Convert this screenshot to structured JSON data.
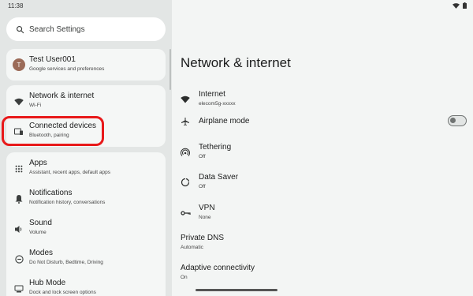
{
  "status_bar": {
    "time": "11:38"
  },
  "search": {
    "placeholder": "Search Settings"
  },
  "account": {
    "avatar_letter": "T",
    "name": "Test User001",
    "subtitle": "Google services and preferences"
  },
  "left_items": [
    {
      "title": "Network & internet",
      "subtitle": "Wi-Fi",
      "icon": "wifi-icon"
    },
    {
      "title": "Connected devices",
      "subtitle": "Bluetooth, pairing",
      "icon": "devices-icon"
    },
    {
      "title": "Apps",
      "subtitle": "Assistant, recent apps, default apps",
      "icon": "apps-grid-icon"
    },
    {
      "title": "Notifications",
      "subtitle": "Notification history, conversations",
      "icon": "bell-icon"
    },
    {
      "title": "Sound",
      "subtitle": "Volume",
      "icon": "volume-icon"
    },
    {
      "title": "Modes",
      "subtitle": "Do Not Disturb, Bedtime, Driving",
      "icon": "do-not-disturb-icon"
    },
    {
      "title": "Hub Mode",
      "subtitle": "Dock and lock screen options",
      "icon": "dock-icon"
    }
  ],
  "detail": {
    "title": "Network & internet",
    "items": [
      {
        "title": "Internet",
        "subtitle": "elecom5g-xxxxx",
        "icon": "wifi-icon"
      },
      {
        "title": "Airplane mode",
        "subtitle": "",
        "icon": "airplane-icon",
        "toggle_on": false
      },
      {
        "title": "Tethering",
        "subtitle": "Off",
        "icon": "hotspot-icon"
      },
      {
        "title": "Data Saver",
        "subtitle": "Off",
        "icon": "data-saver-icon"
      },
      {
        "title": "VPN",
        "subtitle": "None",
        "icon": "vpn-key-icon"
      },
      {
        "title": "Private DNS",
        "subtitle": "Automatic",
        "icon": ""
      },
      {
        "title": "Adaptive connectivity",
        "subtitle": "On",
        "icon": ""
      }
    ]
  },
  "colors": {
    "highlight": "#e8191a",
    "avatar": "#9b6b58"
  }
}
